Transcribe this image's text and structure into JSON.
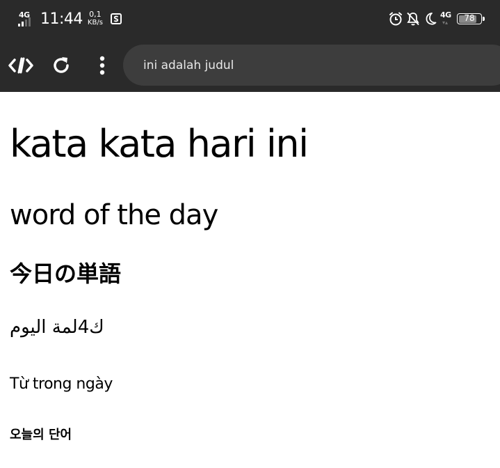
{
  "status_bar": {
    "network_left": "4G",
    "time": "11:44",
    "speed_value": "0,1",
    "speed_unit": "KB/s",
    "notification_icon": "screenshot-icon",
    "icons_right": [
      "alarm-icon",
      "silent-icon",
      "moon-icon"
    ],
    "network_right": "4G",
    "battery_level": "78"
  },
  "browser": {
    "dev_tools_icon": "code-icon",
    "reload_icon": "reload-icon",
    "menu_icon": "more-vert-icon",
    "address_text": "ini adalah judul"
  },
  "page": {
    "headings": [
      "kata kata hari ini",
      "word of the day",
      "今日の単語",
      "ك4لمة اليوم",
      "Từ trong ngày",
      "오늘의 단어"
    ]
  }
}
